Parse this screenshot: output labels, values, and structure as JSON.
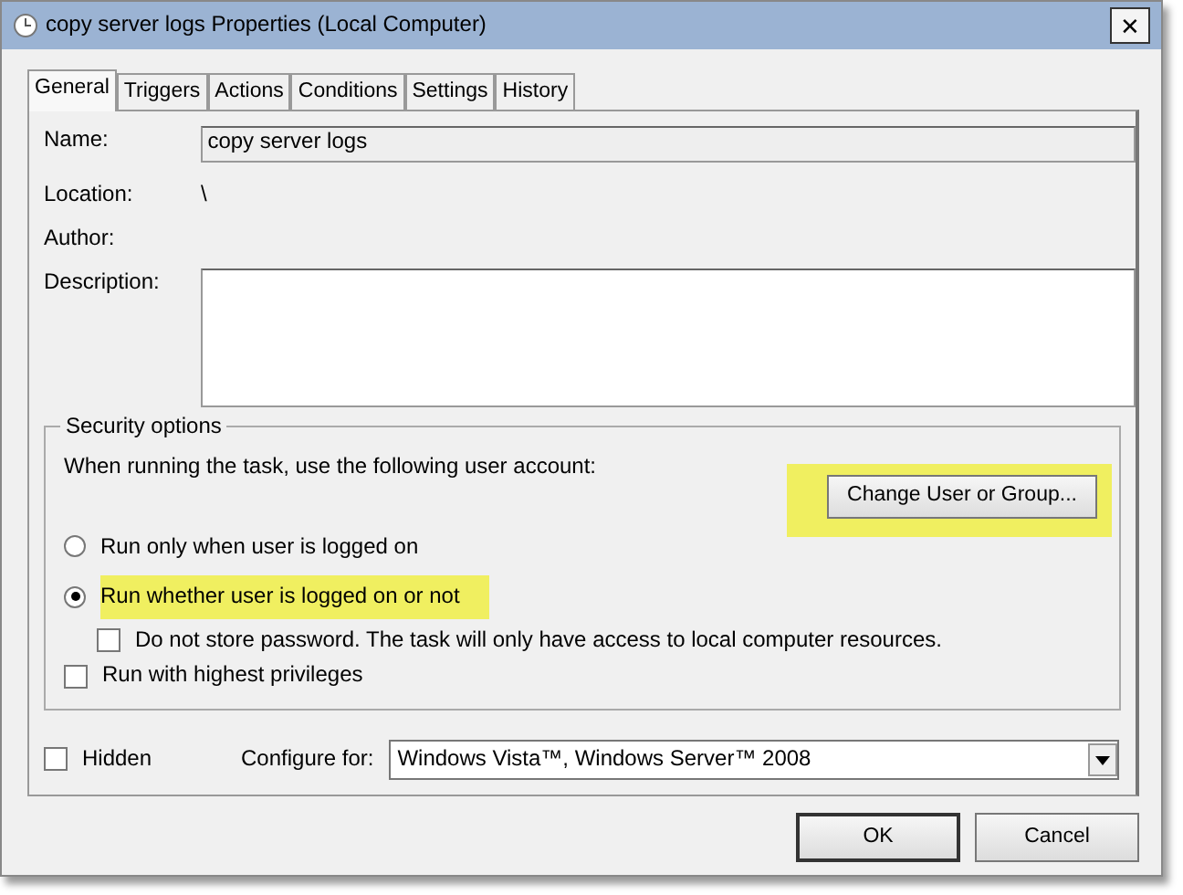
{
  "window": {
    "title": "copy server logs Properties (Local Computer)",
    "close": "✕"
  },
  "tabs": [
    {
      "label": "General",
      "selected": true
    },
    {
      "label": "Triggers",
      "selected": false
    },
    {
      "label": "Actions",
      "selected": false
    },
    {
      "label": "Conditions",
      "selected": false
    },
    {
      "label": "Settings",
      "selected": false
    },
    {
      "label": "History",
      "selected": false
    }
  ],
  "fields": [
    {
      "kind": "input",
      "label": "Name:",
      "value": "copy server logs"
    },
    {
      "kind": "text",
      "label": "Location:",
      "value": "\\"
    },
    {
      "kind": "text",
      "label": "Author:"
    },
    {
      "kind": "textarea",
      "label": "Description:"
    }
  ],
  "security": {
    "legend": "Security options",
    "prompt": "When running the task, use the following user account:",
    "change_button": {
      "label": "Change User or Group...",
      "highlighted": true
    },
    "options": [
      {
        "kind": "radio",
        "label": "Run only when user is logged on",
        "selected": false,
        "highlighted": false
      },
      {
        "kind": "radio",
        "label": "Run whether user is logged on or not",
        "selected": true,
        "highlighted": true
      },
      {
        "kind": "subcheck",
        "label": "Do not store password.  The task will only have access to local computer resources.",
        "checked": false
      },
      {
        "kind": "check",
        "label": "Run with highest privileges",
        "checked": false
      }
    ]
  },
  "hidden": {
    "label": "Hidden",
    "checked": false
  },
  "configure": {
    "label": "Configure for:",
    "value": "Windows Vista™, Windows Server™ 2008"
  },
  "buttons": [
    {
      "label": "OK",
      "default": true
    },
    {
      "label": "Cancel",
      "default": false
    }
  ]
}
